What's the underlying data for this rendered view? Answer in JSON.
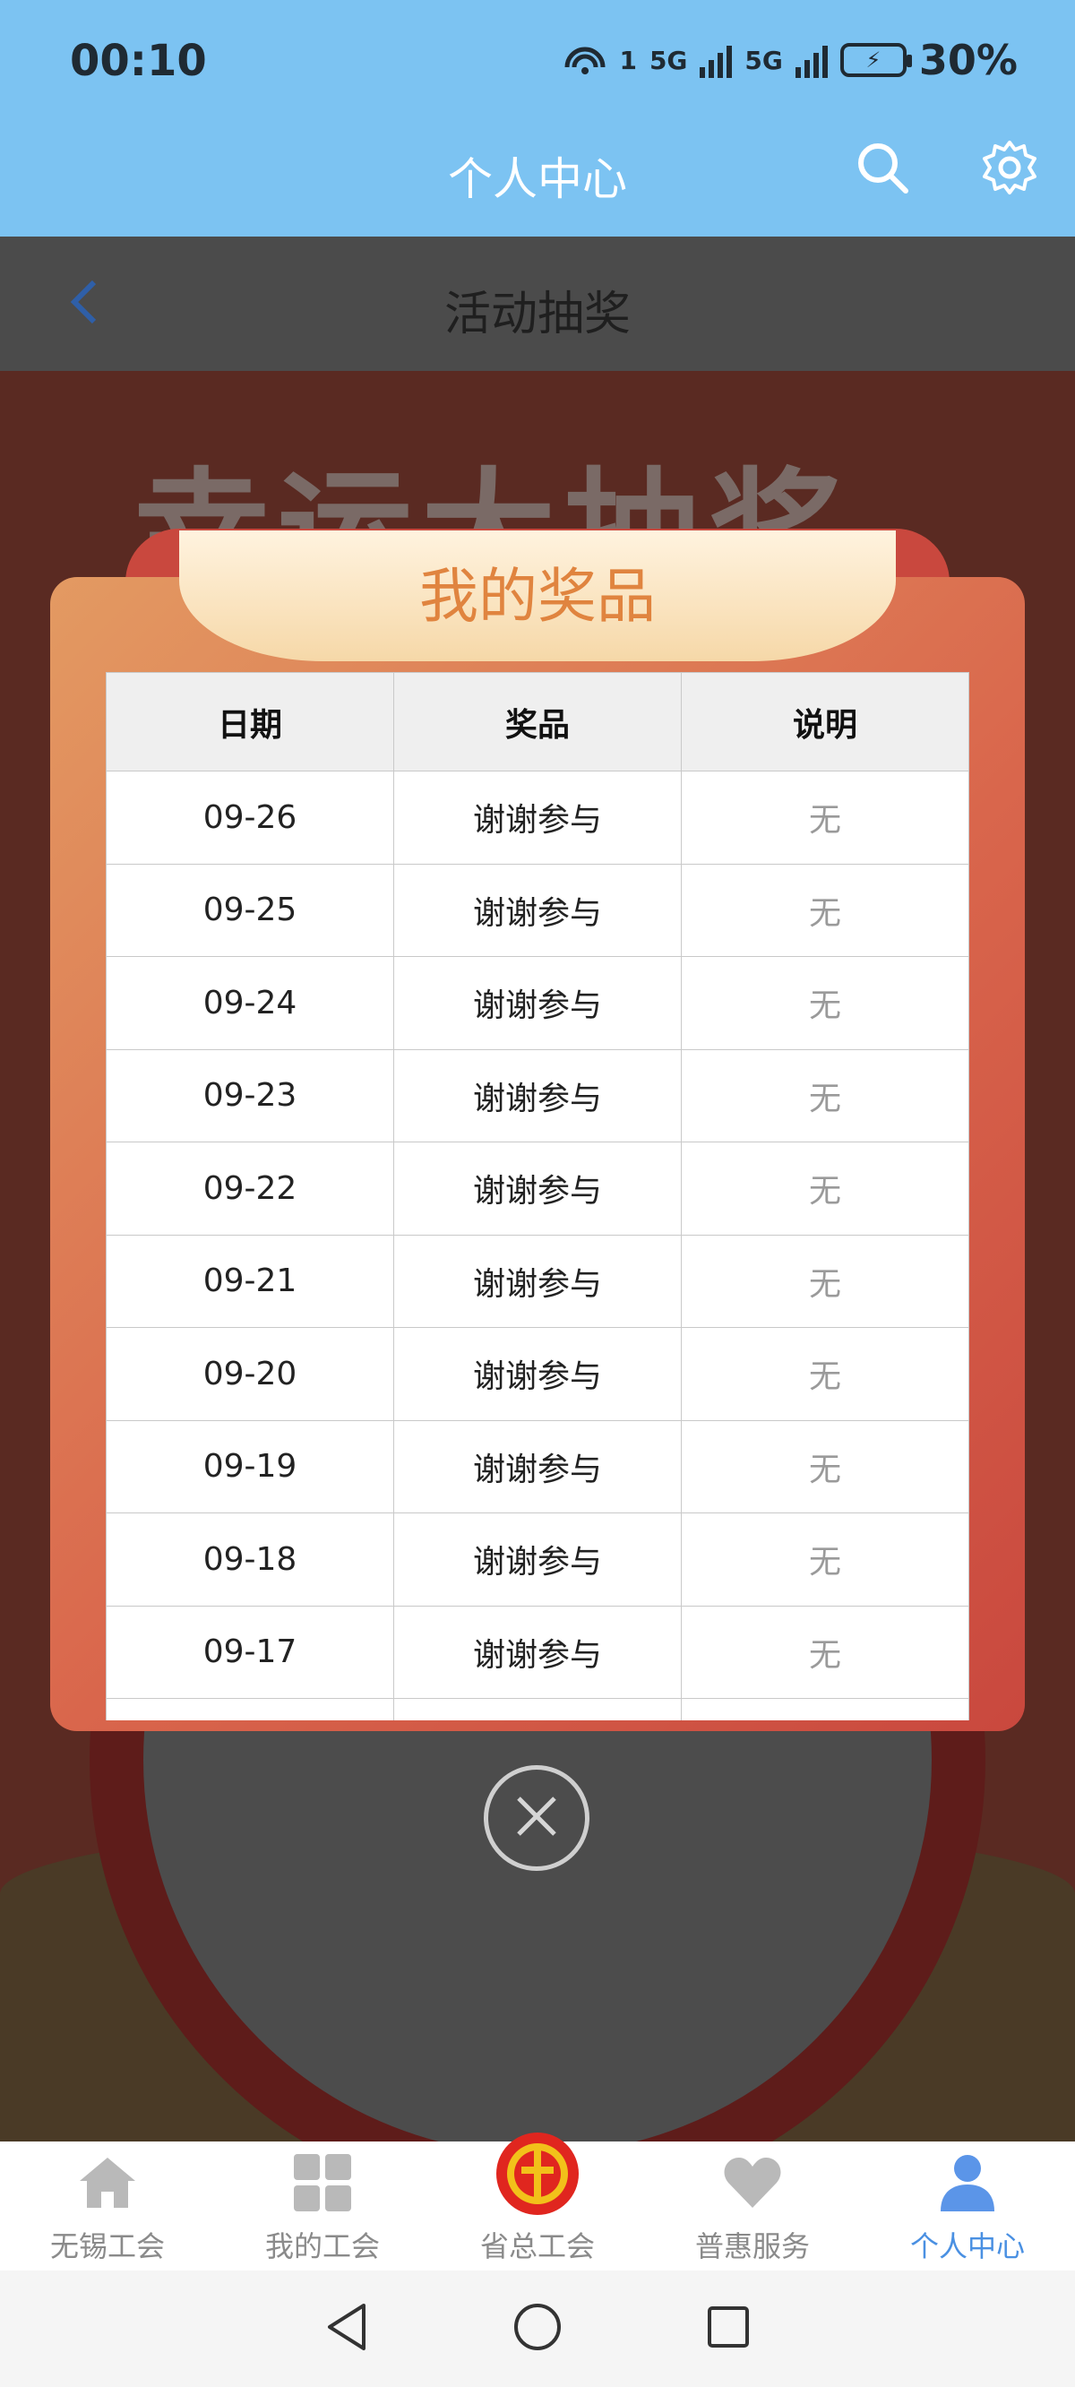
{
  "status_bar": {
    "time": "00:10",
    "signal_label_1": "5G",
    "signal_label_2": "5G",
    "hotspot_index": "1",
    "battery_percent": "30%"
  },
  "header": {
    "title": "个人中心"
  },
  "sub_header": {
    "title": "活动抽奖"
  },
  "background": {
    "big_text": "幸运大抽奖"
  },
  "modal": {
    "title": "我的奖品",
    "columns": [
      "日期",
      "奖品",
      "说明"
    ],
    "rows": [
      {
        "date": "09-26",
        "prize": "谢谢参与",
        "note": "无"
      },
      {
        "date": "09-25",
        "prize": "谢谢参与",
        "note": "无"
      },
      {
        "date": "09-24",
        "prize": "谢谢参与",
        "note": "无"
      },
      {
        "date": "09-23",
        "prize": "谢谢参与",
        "note": "无"
      },
      {
        "date": "09-22",
        "prize": "谢谢参与",
        "note": "无"
      },
      {
        "date": "09-21",
        "prize": "谢谢参与",
        "note": "无"
      },
      {
        "date": "09-20",
        "prize": "谢谢参与",
        "note": "无"
      },
      {
        "date": "09-19",
        "prize": "谢谢参与",
        "note": "无"
      },
      {
        "date": "09-18",
        "prize": "谢谢参与",
        "note": "无"
      },
      {
        "date": "09-17",
        "prize": "谢谢参与",
        "note": "无"
      }
    ]
  },
  "bottom_nav": {
    "items": [
      {
        "label": "无锡工会",
        "icon": "home-icon",
        "active": false
      },
      {
        "label": "我的工会",
        "icon": "grid-icon",
        "active": false
      },
      {
        "label": "省总工会",
        "icon": "union-emblem-icon",
        "active": false
      },
      {
        "label": "普惠服务",
        "icon": "heart-icon",
        "active": false
      },
      {
        "label": "个人中心",
        "icon": "person-icon",
        "active": true
      }
    ]
  },
  "colors": {
    "header_bg": "#7cc3f2",
    "accent_active": "#4a90e2",
    "modal_title": "#e0843f"
  }
}
